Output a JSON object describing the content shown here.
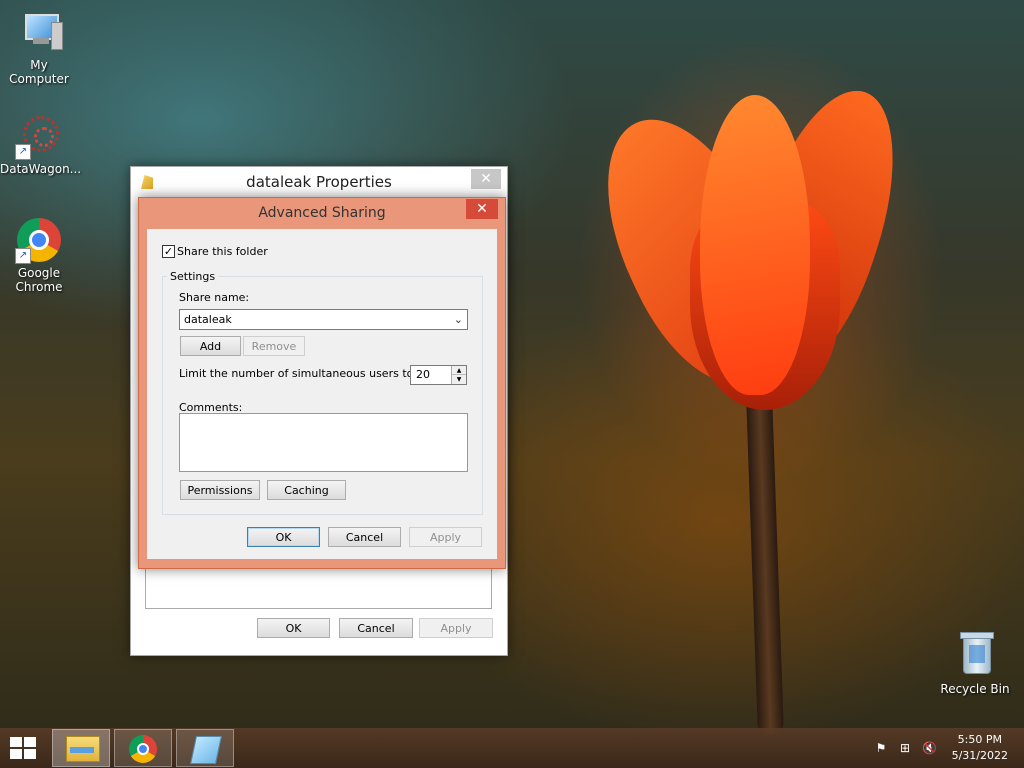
{
  "desktop": {
    "icons": [
      {
        "label": "My Computer"
      },
      {
        "label": "DataWagon..."
      },
      {
        "label": "Google Chrome"
      },
      {
        "label": "Recycle Bin"
      }
    ]
  },
  "properties_window": {
    "title": "dataleak Properties",
    "close_icon": "✕",
    "ok_label": "OK",
    "cancel_label": "Cancel",
    "apply_label": "Apply"
  },
  "advanced_sharing": {
    "title": "Advanced Sharing",
    "close_icon": "✕",
    "share_folder_label": "Share this folder",
    "share_folder_checked": "✓",
    "settings_group_label": "Settings",
    "share_name_label": "Share name:",
    "share_name_value": "dataleak",
    "add_label": "Add",
    "remove_label": "Remove",
    "limit_users_label": "Limit the number of simultaneous users to:",
    "limit_users_value": "20",
    "comments_label": "Comments:",
    "comments_value": "",
    "permissions_label": "Permissions",
    "caching_label": "Caching",
    "ok_label": "OK",
    "cancel_label": "Cancel",
    "apply_label": "Apply"
  },
  "taskbar": {
    "clock_time": "5:50 PM",
    "clock_date": "5/31/2022",
    "colors": {
      "accent": "#e9967a",
      "close_red": "#d64a3a"
    }
  }
}
